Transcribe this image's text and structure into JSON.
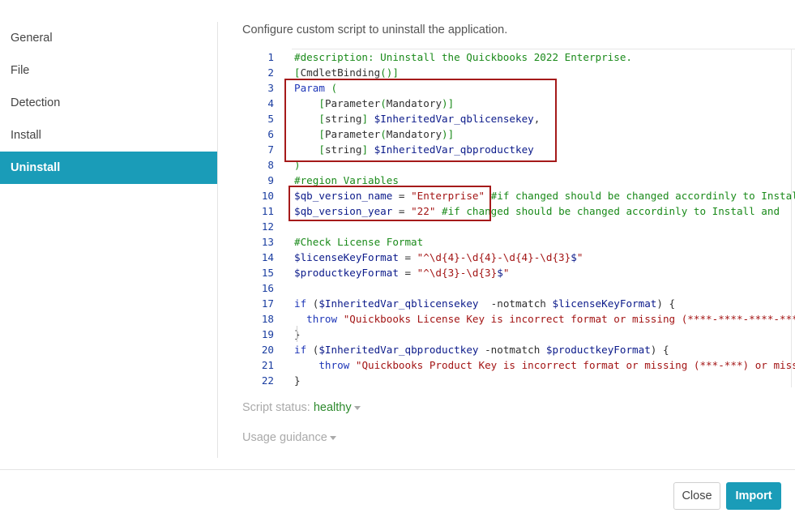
{
  "sidebar": {
    "items": [
      {
        "label": "General"
      },
      {
        "label": "File"
      },
      {
        "label": "Detection"
      },
      {
        "label": "Install"
      },
      {
        "label": "Uninstall"
      }
    ],
    "active": "Uninstall"
  },
  "main": {
    "description": "Configure custom script to uninstall the application.",
    "script_status_label": "Script status:",
    "script_status_value": "healthy",
    "usage_guidance_label": "Usage guidance"
  },
  "editor": {
    "lines": [
      {
        "n": "1",
        "tokens": [
          [
            "cm",
            "#description: Uninstall the Quickbooks 2022 Enterprise."
          ]
        ]
      },
      {
        "n": "2",
        "tokens": [
          [
            "br",
            "["
          ],
          [
            "tx",
            "CmdletBinding"
          ],
          [
            "br",
            "()]"
          ]
        ]
      },
      {
        "n": "3",
        "tokens": [
          [
            "kw",
            "Param"
          ],
          [
            "tx",
            " "
          ],
          [
            "br",
            "("
          ]
        ]
      },
      {
        "n": "4",
        "tokens": [
          [
            "tx",
            "    "
          ],
          [
            "br",
            "["
          ],
          [
            "tp",
            "Parameter"
          ],
          [
            "br",
            "("
          ],
          [
            "tp",
            "Mandatory"
          ],
          [
            "br",
            ")]"
          ]
        ]
      },
      {
        "n": "5",
        "tokens": [
          [
            "tx",
            "    "
          ],
          [
            "br",
            "["
          ],
          [
            "tp",
            "string"
          ],
          [
            "br",
            "]"
          ],
          [
            "tx",
            " "
          ],
          [
            "vr",
            "$InheritedVar_qblicensekey"
          ],
          [
            "tx",
            ","
          ]
        ]
      },
      {
        "n": "6",
        "tokens": [
          [
            "tx",
            "    "
          ],
          [
            "br",
            "["
          ],
          [
            "tp",
            "Parameter"
          ],
          [
            "br",
            "("
          ],
          [
            "tp",
            "Mandatory"
          ],
          [
            "br",
            ")]"
          ]
        ]
      },
      {
        "n": "7",
        "tokens": [
          [
            "tx",
            "    "
          ],
          [
            "br",
            "["
          ],
          [
            "tp",
            "string"
          ],
          [
            "br",
            "]"
          ],
          [
            "tx",
            " "
          ],
          [
            "vr",
            "$InheritedVar_qbproductkey"
          ]
        ]
      },
      {
        "n": "8",
        "tokens": [
          [
            "br",
            ")"
          ]
        ]
      },
      {
        "n": "9",
        "tokens": [
          [
            "cm",
            "#region Variables"
          ]
        ]
      },
      {
        "n": "10",
        "tokens": [
          [
            "vr",
            "$qb_version_name"
          ],
          [
            "tx",
            " = "
          ],
          [
            "st",
            "\"Enterprise\""
          ],
          [
            "tx",
            " "
          ],
          [
            "cm",
            "#if changed should be changed accordinly to Install and"
          ]
        ]
      },
      {
        "n": "11",
        "tokens": [
          [
            "vr",
            "$qb_version_year"
          ],
          [
            "tx",
            " = "
          ],
          [
            "st",
            "\"22\""
          ],
          [
            "tx",
            " "
          ],
          [
            "cm",
            "#if changed should be changed accordinly to Install and"
          ]
        ]
      },
      {
        "n": "12",
        "tokens": []
      },
      {
        "n": "13",
        "tokens": [
          [
            "cm",
            "#Check License Format"
          ]
        ]
      },
      {
        "n": "14",
        "tokens": [
          [
            "vr",
            "$licenseKeyFormat"
          ],
          [
            "tx",
            " = "
          ],
          [
            "st",
            "\"^\\d{4}-\\d{4}-\\d{4}-\\d{3}"
          ],
          [
            "vr",
            "$"
          ],
          [
            "st",
            "\""
          ]
        ]
      },
      {
        "n": "15",
        "tokens": [
          [
            "vr",
            "$productkeyFormat"
          ],
          [
            "tx",
            " = "
          ],
          [
            "st",
            "\"^\\d{3}-\\d{3}"
          ],
          [
            "vr",
            "$"
          ],
          [
            "st",
            "\""
          ]
        ]
      },
      {
        "n": "16",
        "tokens": []
      },
      {
        "n": "17",
        "tokens": [
          [
            "kw",
            "if"
          ],
          [
            "tx",
            " ("
          ],
          [
            "vr",
            "$InheritedVar_qblicensekey"
          ],
          [
            "tx",
            "  -notmatch "
          ],
          [
            "vr",
            "$licenseKeyFormat"
          ],
          [
            "tx",
            ") {"
          ]
        ]
      },
      {
        "n": "18",
        "tokens": [
          [
            "tx",
            "  "
          ],
          [
            "kw",
            "throw"
          ],
          [
            "tx",
            " "
          ],
          [
            "st",
            "\"Quickbooks License Key is incorrect format or missing (****-****-****-***)"
          ]
        ]
      },
      {
        "n": "19",
        "tokens": [
          [
            "tx",
            "}"
          ]
        ]
      },
      {
        "n": "20",
        "tokens": [
          [
            "kw",
            "if"
          ],
          [
            "tx",
            " ("
          ],
          [
            "vr",
            "$InheritedVar_qbproductkey"
          ],
          [
            "tx",
            " -notmatch "
          ],
          [
            "vr",
            "$productkeyFormat"
          ],
          [
            "tx",
            ") {"
          ]
        ]
      },
      {
        "n": "21",
        "tokens": [
          [
            "tx",
            "    "
          ],
          [
            "kw",
            "throw"
          ],
          [
            "tx",
            " "
          ],
          [
            "st",
            "\"Quickbooks Product Key is incorrect format or missing (***-***) or missing"
          ]
        ]
      },
      {
        "n": "22",
        "tokens": [
          [
            "tx",
            "}"
          ]
        ]
      }
    ]
  },
  "footer": {
    "close_label": "Close",
    "import_label": "Import"
  },
  "colors": {
    "accent": "#1a9cb8",
    "highlight_box": "#a51a1a",
    "status_ok": "#2d8a2d"
  }
}
